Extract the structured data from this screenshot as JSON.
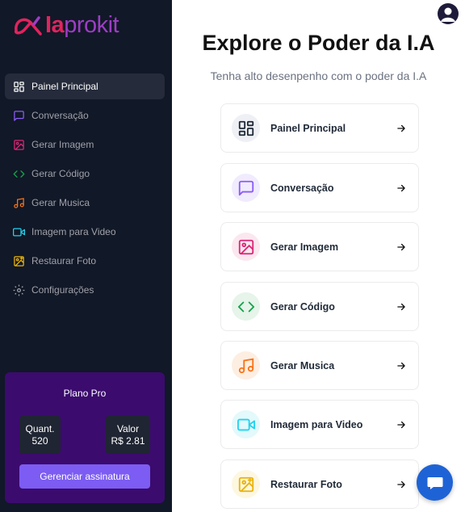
{
  "brand": {
    "part1": "Ia",
    "part2": "prokit",
    "color1": "#e0245e",
    "color2": "#9d3dc4"
  },
  "sidebar": {
    "items": [
      {
        "label": "Painel Principal",
        "icon": "dashboard-icon",
        "color": "#ffffff",
        "active": true
      },
      {
        "label": "Conversação",
        "icon": "message-icon",
        "color": "#8b5cf6"
      },
      {
        "label": "Gerar Imagem",
        "icon": "image-icon",
        "color": "#db2777"
      },
      {
        "label": "Gerar Código",
        "icon": "code-icon",
        "color": "#16a34a"
      },
      {
        "label": "Gerar Musica",
        "icon": "music-icon",
        "color": "#f97316"
      },
      {
        "label": "Imagem para Video",
        "icon": "video-icon",
        "color": "#22d3ee"
      },
      {
        "label": "Restaurar Foto",
        "icon": "image-restore-icon",
        "color": "#eab308"
      },
      {
        "label": "Configurações",
        "icon": "gear-icon",
        "color": "#a1a1aa"
      }
    ]
  },
  "plan": {
    "title": "Plano Pro",
    "quant_label": "Quant.",
    "quant_value": "520",
    "valor_label": "Valor",
    "valor_value": "R$ 2.81",
    "manage_label": "Gerenciar assinatura"
  },
  "main": {
    "title": "Explore o Poder da I.A",
    "subtitle": "Tenha alto desenpenho com o poder da I.A",
    "cards": [
      {
        "label": "Painel Principal",
        "icon": "dashboard-icon",
        "color": "#1f2937",
        "bg": "#eef0f5"
      },
      {
        "label": "Conversação",
        "icon": "message-icon",
        "color": "#8b5cf6",
        "bg": "#f1ebfe"
      },
      {
        "label": "Gerar Imagem",
        "icon": "image-icon",
        "color": "#db2777",
        "bg": "#fbe7ef"
      },
      {
        "label": "Gerar Código",
        "icon": "code-icon",
        "color": "#16a34a",
        "bg": "#e6f4ea"
      },
      {
        "label": "Gerar Musica",
        "icon": "music-icon",
        "color": "#f97316",
        "bg": "#fdeee2"
      },
      {
        "label": "Imagem para Video",
        "icon": "video-icon",
        "color": "#22d3ee",
        "bg": "#e3f9fc"
      },
      {
        "label": "Restaurar Foto",
        "icon": "image-restore-icon",
        "color": "#eab308",
        "bg": "#fdf7e0"
      }
    ]
  }
}
